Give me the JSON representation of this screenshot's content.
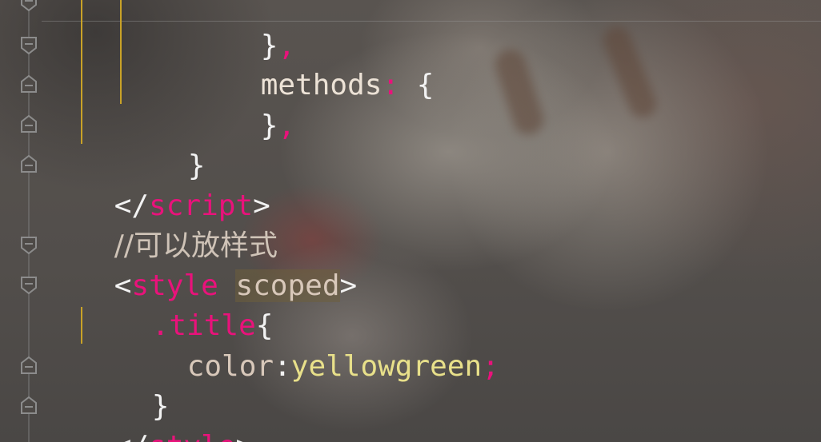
{
  "colors": {
    "tag_name": "#e9127b",
    "punctuation": "#f2f2f2",
    "value": "#e8e08a",
    "indent_guide": "#c9a227",
    "attribute_highlight": "#6e5f3c"
  },
  "code": {
    "line1": {
      "brace_close": "}",
      "comma": ","
    },
    "line2": {
      "key": "methods",
      "colon": ":",
      "brace_open": " {"
    },
    "line3": {
      "brace_close": "}",
      "comma": ","
    },
    "line4": {
      "brace_close": "}"
    },
    "line5": {
      "open": "</",
      "tag": "script",
      "close": ">"
    },
    "line6": {
      "comment": "//可以放样式"
    },
    "line7": {
      "open": "<",
      "tag": "style",
      "space": " ",
      "attr": "scoped",
      "close": ">"
    },
    "line8": {
      "selector": ".title",
      "brace_open": "{"
    },
    "line9": {
      "property": "color",
      "colon": ":",
      "value": "yellowgreen",
      "semi": ";"
    },
    "line10": {
      "brace_close": "}"
    },
    "line11": {
      "open": "</",
      "tag": "style",
      "close": ">"
    }
  },
  "icons": {
    "fold_marker": "fold-marker-icon"
  }
}
